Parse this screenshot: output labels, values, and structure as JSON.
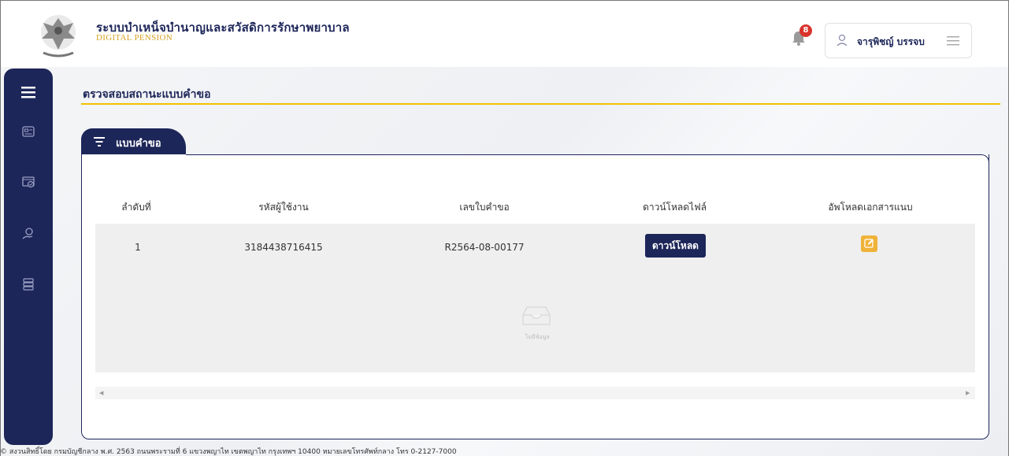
{
  "header": {
    "title": "ระบบบำเหน็จบำนาญและสวัสดิการรักษาพยาบาล",
    "subtitle": "DIGITAL PENSION",
    "notification_count": "8",
    "user_name": "จารุพิชญ์ บรรจบ"
  },
  "page": {
    "title": "ตรวจสอบสถานะแบบคำขอ",
    "tab_label": "แบบคำขอ"
  },
  "table": {
    "columns": [
      "ลำดับที่",
      "รหัสผู้ใช้งาน",
      "เลขใบคำขอ",
      "ดาวน์โหลดไฟล์",
      "อัพโหลดเอกสารแนบ"
    ],
    "rows": [
      {
        "no": "1",
        "user_code": "3184438716415",
        "request_no": "R2564-08-00177",
        "download_label": "ดาวน์โหลด"
      }
    ],
    "empty_text": "ไม่มีข้อมูล"
  },
  "footer": {
    "text": "© สงวนสิทธิ์โดย กรมบัญชีกลาง พ.ศ. 2563 ถนนพระรามที่ 6 แขวงพญาไท เขตพญาไท กรุงเทพฯ 10400 หมายเลขโทรศัพท์กลาง โทร 0-2127-7000"
  },
  "colors": {
    "primary": "#1d2659",
    "accent": "#f2c200",
    "badge": "#d8342c",
    "edit": "#f0b33a"
  },
  "icons": {
    "logo": "garuda-emblem-icon",
    "bell": "bell-icon",
    "user": "user-icon",
    "menu": "hamburger-icon",
    "sidebar": [
      "hamburger-icon",
      "id-card-icon",
      "document-check-icon",
      "hand-money-icon",
      "server-icon"
    ],
    "tab": "filter-icon",
    "edit": "edit-icon",
    "empty": "inbox-icon"
  }
}
